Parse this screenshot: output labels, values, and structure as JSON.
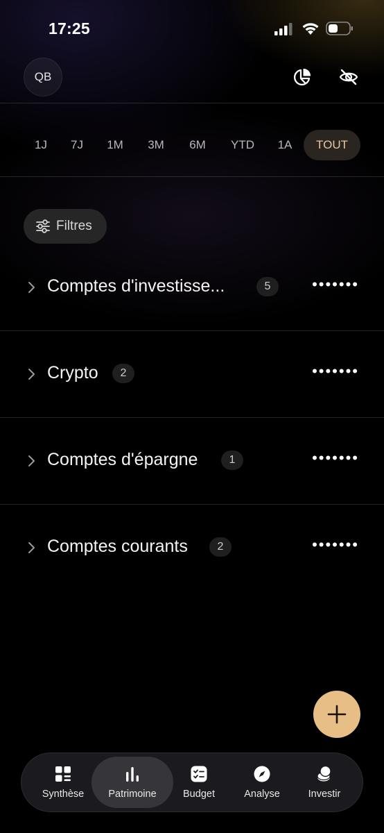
{
  "status_bar": {
    "time": "17:25"
  },
  "header": {
    "avatar_initials": "QB"
  },
  "periods": {
    "items": [
      "1J",
      "7J",
      "1M",
      "3M",
      "6M",
      "YTD",
      "1A",
      "TOUT"
    ],
    "selected": "TOUT"
  },
  "filters": {
    "label": "Filtres"
  },
  "accounts": [
    {
      "name": "Comptes d'investisse...",
      "count": "5",
      "masked_value": "•••••••"
    },
    {
      "name": "Crypto",
      "count": "2",
      "masked_value": "•••••••"
    },
    {
      "name": "Comptes d'épargne",
      "count": "1",
      "masked_value": "•••••••"
    },
    {
      "name": "Comptes courants",
      "count": "2",
      "masked_value": "•••••••"
    }
  ],
  "tabs": [
    {
      "label": "Synthèse",
      "icon": "grid-icon"
    },
    {
      "label": "Patrimoine",
      "icon": "bar-chart-icon",
      "active": true
    },
    {
      "label": "Budget",
      "icon": "checklist-icon"
    },
    {
      "label": "Analyse",
      "icon": "compass-icon"
    },
    {
      "label": "Investir",
      "icon": "coins-icon"
    }
  ],
  "colors": {
    "accent": "#e7bf86",
    "selected_period_text": "#e6c79a",
    "background": "#000000"
  }
}
